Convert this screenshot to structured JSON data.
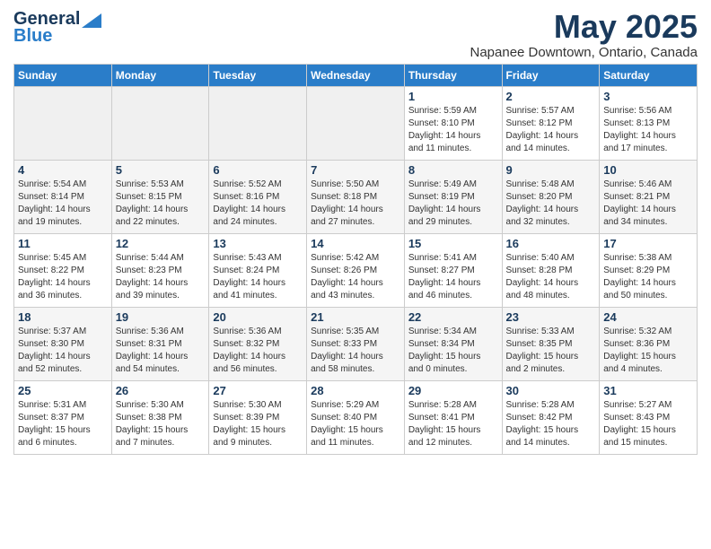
{
  "header": {
    "logo_general": "General",
    "logo_blue": "Blue",
    "title": "May 2025",
    "subtitle": "Napanee Downtown, Ontario, Canada"
  },
  "calendar": {
    "days_of_week": [
      "Sunday",
      "Monday",
      "Tuesday",
      "Wednesday",
      "Thursday",
      "Friday",
      "Saturday"
    ],
    "weeks": [
      [
        {
          "day": "",
          "content": ""
        },
        {
          "day": "",
          "content": ""
        },
        {
          "day": "",
          "content": ""
        },
        {
          "day": "",
          "content": ""
        },
        {
          "day": "1",
          "content": "Sunrise: 5:59 AM\nSunset: 8:10 PM\nDaylight: 14 hours\nand 11 minutes."
        },
        {
          "day": "2",
          "content": "Sunrise: 5:57 AM\nSunset: 8:12 PM\nDaylight: 14 hours\nand 14 minutes."
        },
        {
          "day": "3",
          "content": "Sunrise: 5:56 AM\nSunset: 8:13 PM\nDaylight: 14 hours\nand 17 minutes."
        }
      ],
      [
        {
          "day": "4",
          "content": "Sunrise: 5:54 AM\nSunset: 8:14 PM\nDaylight: 14 hours\nand 19 minutes."
        },
        {
          "day": "5",
          "content": "Sunrise: 5:53 AM\nSunset: 8:15 PM\nDaylight: 14 hours\nand 22 minutes."
        },
        {
          "day": "6",
          "content": "Sunrise: 5:52 AM\nSunset: 8:16 PM\nDaylight: 14 hours\nand 24 minutes."
        },
        {
          "day": "7",
          "content": "Sunrise: 5:50 AM\nSunset: 8:18 PM\nDaylight: 14 hours\nand 27 minutes."
        },
        {
          "day": "8",
          "content": "Sunrise: 5:49 AM\nSunset: 8:19 PM\nDaylight: 14 hours\nand 29 minutes."
        },
        {
          "day": "9",
          "content": "Sunrise: 5:48 AM\nSunset: 8:20 PM\nDaylight: 14 hours\nand 32 minutes."
        },
        {
          "day": "10",
          "content": "Sunrise: 5:46 AM\nSunset: 8:21 PM\nDaylight: 14 hours\nand 34 minutes."
        }
      ],
      [
        {
          "day": "11",
          "content": "Sunrise: 5:45 AM\nSunset: 8:22 PM\nDaylight: 14 hours\nand 36 minutes."
        },
        {
          "day": "12",
          "content": "Sunrise: 5:44 AM\nSunset: 8:23 PM\nDaylight: 14 hours\nand 39 minutes."
        },
        {
          "day": "13",
          "content": "Sunrise: 5:43 AM\nSunset: 8:24 PM\nDaylight: 14 hours\nand 41 minutes."
        },
        {
          "day": "14",
          "content": "Sunrise: 5:42 AM\nSunset: 8:26 PM\nDaylight: 14 hours\nand 43 minutes."
        },
        {
          "day": "15",
          "content": "Sunrise: 5:41 AM\nSunset: 8:27 PM\nDaylight: 14 hours\nand 46 minutes."
        },
        {
          "day": "16",
          "content": "Sunrise: 5:40 AM\nSunset: 8:28 PM\nDaylight: 14 hours\nand 48 minutes."
        },
        {
          "day": "17",
          "content": "Sunrise: 5:38 AM\nSunset: 8:29 PM\nDaylight: 14 hours\nand 50 minutes."
        }
      ],
      [
        {
          "day": "18",
          "content": "Sunrise: 5:37 AM\nSunset: 8:30 PM\nDaylight: 14 hours\nand 52 minutes."
        },
        {
          "day": "19",
          "content": "Sunrise: 5:36 AM\nSunset: 8:31 PM\nDaylight: 14 hours\nand 54 minutes."
        },
        {
          "day": "20",
          "content": "Sunrise: 5:36 AM\nSunset: 8:32 PM\nDaylight: 14 hours\nand 56 minutes."
        },
        {
          "day": "21",
          "content": "Sunrise: 5:35 AM\nSunset: 8:33 PM\nDaylight: 14 hours\nand 58 minutes."
        },
        {
          "day": "22",
          "content": "Sunrise: 5:34 AM\nSunset: 8:34 PM\nDaylight: 15 hours\nand 0 minutes."
        },
        {
          "day": "23",
          "content": "Sunrise: 5:33 AM\nSunset: 8:35 PM\nDaylight: 15 hours\nand 2 minutes."
        },
        {
          "day": "24",
          "content": "Sunrise: 5:32 AM\nSunset: 8:36 PM\nDaylight: 15 hours\nand 4 minutes."
        }
      ],
      [
        {
          "day": "25",
          "content": "Sunrise: 5:31 AM\nSunset: 8:37 PM\nDaylight: 15 hours\nand 6 minutes."
        },
        {
          "day": "26",
          "content": "Sunrise: 5:30 AM\nSunset: 8:38 PM\nDaylight: 15 hours\nand 7 minutes."
        },
        {
          "day": "27",
          "content": "Sunrise: 5:30 AM\nSunset: 8:39 PM\nDaylight: 15 hours\nand 9 minutes."
        },
        {
          "day": "28",
          "content": "Sunrise: 5:29 AM\nSunset: 8:40 PM\nDaylight: 15 hours\nand 11 minutes."
        },
        {
          "day": "29",
          "content": "Sunrise: 5:28 AM\nSunset: 8:41 PM\nDaylight: 15 hours\nand 12 minutes."
        },
        {
          "day": "30",
          "content": "Sunrise: 5:28 AM\nSunset: 8:42 PM\nDaylight: 15 hours\nand 14 minutes."
        },
        {
          "day": "31",
          "content": "Sunrise: 5:27 AM\nSunset: 8:43 PM\nDaylight: 15 hours\nand 15 minutes."
        }
      ]
    ]
  }
}
